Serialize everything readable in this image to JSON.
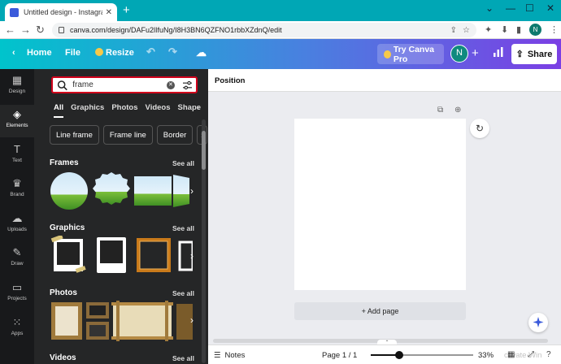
{
  "browser": {
    "tab_title": "Untitled design - Instagram Post",
    "url": "canva.com/design/DAFu2lIfuNg/I8H3BN6QZFNO1rbbXZdnQ/edit",
    "profile_initial": "N"
  },
  "header": {
    "home_label": "Home",
    "file_label": "File",
    "resize_label": "Resize",
    "try_pro_label": "Try Canva Pro",
    "avatar_initial": "N",
    "share_label": "Share",
    "gradient_start": "#00c4cc",
    "gradient_end": "#7b3fe4"
  },
  "rail": {
    "items": [
      {
        "label": "Design",
        "icon": "layout-icon"
      },
      {
        "label": "Elements",
        "icon": "shapes-icon",
        "active": true
      },
      {
        "label": "Text",
        "icon": "text-icon"
      },
      {
        "label": "Brand",
        "icon": "brand-icon"
      },
      {
        "label": "Uploads",
        "icon": "upload-icon"
      },
      {
        "label": "Draw",
        "icon": "pen-icon"
      },
      {
        "label": "Projects",
        "icon": "folder-icon"
      },
      {
        "label": "Apps",
        "icon": "grid-icon"
      }
    ]
  },
  "panel": {
    "search_value": "frame",
    "search_border_color": "#d0021b",
    "filter_tabs": [
      "All",
      "Graphics",
      "Photos",
      "Videos",
      "Shape"
    ],
    "chips": [
      "Line frame",
      "Frame line",
      "Border"
    ],
    "see_all": "See all",
    "sections": {
      "frames": "Frames",
      "graphics": "Graphics",
      "photos": "Photos",
      "videos": "Videos"
    }
  },
  "canvas": {
    "context_label": "Position",
    "add_page_label": "+ Add page"
  },
  "footer": {
    "notes_label": "Notes",
    "page_label": "Page 1 / 1",
    "zoom_label": "33%",
    "zoom_level": 0.28
  }
}
